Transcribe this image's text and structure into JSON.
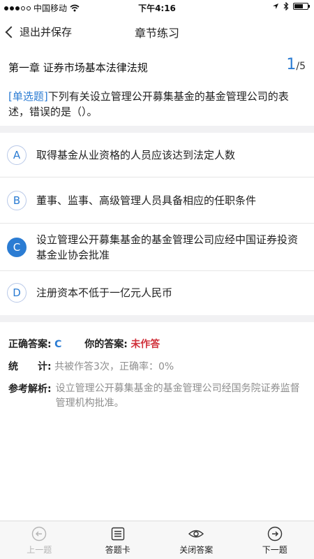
{
  "status": {
    "carrier": "中国移动",
    "time": "下午4:16"
  },
  "nav": {
    "back_label": "退出并保存",
    "title": "章节练习"
  },
  "chapter": {
    "title": "第一章 证券市场基本法律法规",
    "current": "1",
    "total": "/5"
  },
  "question": {
    "type": "[单选题]",
    "text": "下列有关设立管理公开募集基金的基金管理公司的表述，错误的是（）。"
  },
  "options": [
    {
      "letter": "A",
      "text": "取得基金从业资格的人员应该达到法定人数",
      "selected": false
    },
    {
      "letter": "B",
      "text": "董事、监事、高级管理人员具备相应的任职条件",
      "selected": false
    },
    {
      "letter": "C",
      "text": "设立管理公开募集基金的基金管理公司应经中国证券投资基金业协会批准",
      "selected": true
    },
    {
      "letter": "D",
      "text": "注册资本不低于一亿元人民币",
      "selected": false
    }
  ],
  "answer": {
    "correct_label": "正确答案:",
    "correct_value": "C",
    "your_label": "你的答案:",
    "your_value": "未作答",
    "stats_label_1": "统",
    "stats_label_2": "计:",
    "stats_value": "共被作答3次，正确率：0%",
    "analysis_label": "参考解析:",
    "analysis_value": "设立管理公开募集基金的基金管理公司经国务院证券监督管理机构批准。"
  },
  "tabs": {
    "prev": "上一题",
    "card": "答题卡",
    "close_answer": "关闭答案",
    "next": "下一题"
  },
  "colors": {
    "accent": "#2b7cd3",
    "wrong": "#d0313b"
  }
}
